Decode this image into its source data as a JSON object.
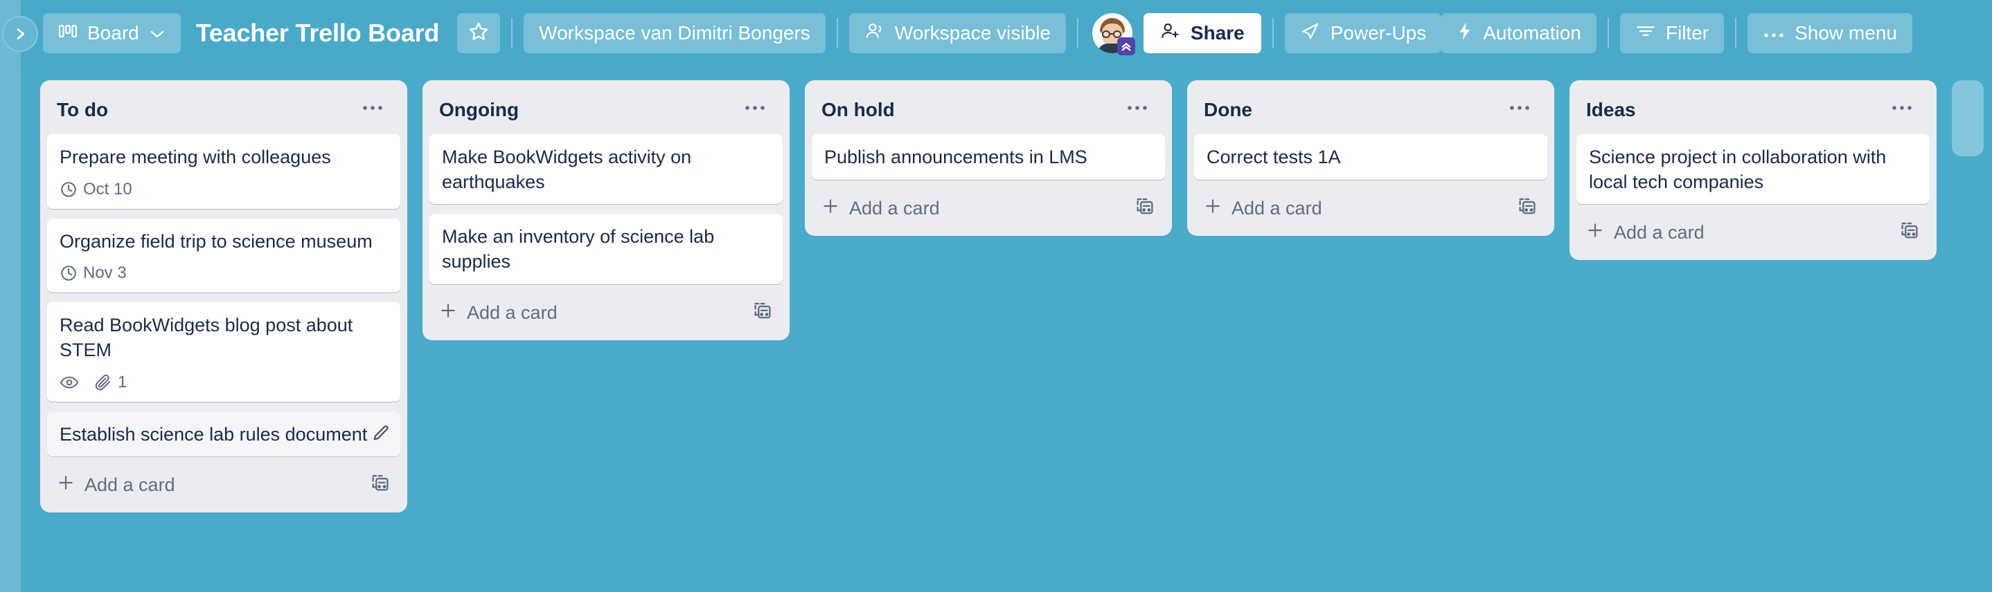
{
  "sidebar": {
    "expand_icon": "chevron-right-icon"
  },
  "topbar": {
    "board_switch": {
      "label": "Board",
      "icon": "board-columns-icon",
      "chevron": "chevron-down-icon"
    },
    "board_title": "Teacher Trello Board",
    "star": {
      "icon": "star-icon"
    },
    "workspace": {
      "label": "Workspace van Dimitri Bongers"
    },
    "visibility": {
      "label": "Workspace visible",
      "icon": "members-icon"
    },
    "avatar": {
      "name": "avatar",
      "badge": "premium-badge"
    },
    "share": {
      "label": "Share",
      "icon": "add-person-icon"
    },
    "power_ups": {
      "label": "Power-Ups",
      "icon": "rocket-icon"
    },
    "automation": {
      "label": "Automation",
      "icon": "bolt-icon"
    },
    "filter": {
      "label": "Filter",
      "icon": "filter-icon"
    },
    "show_menu": {
      "label": "Show menu",
      "icon": "ellipsis-icon"
    }
  },
  "board": {
    "add_card_label": "Add a card",
    "list_menu_icon": "ellipsis-icon",
    "template_icon": "card-template-icon",
    "add_card_icon": "plus-icon",
    "lists": [
      {
        "title": "To do",
        "cards": [
          {
            "title": "Prepare meeting with colleagues",
            "due": "Oct 10",
            "due_icon": "clock-icon"
          },
          {
            "title": "Organize field trip to science museum",
            "due": "Nov 3",
            "due_icon": "clock-icon"
          },
          {
            "title": "Read BookWidgets blog post about STEM",
            "watch_icon": "eye-icon",
            "attachment_icon": "paperclip-icon",
            "attachments": "1"
          },
          {
            "title": "Establish science lab rules document",
            "hovered": true,
            "edit_icon": "pencil-icon"
          }
        ]
      },
      {
        "title": "Ongoing",
        "cards": [
          {
            "title": "Make BookWidgets activity on earthquakes"
          },
          {
            "title": "Make an inventory of science lab supplies"
          }
        ]
      },
      {
        "title": "On hold",
        "cards": [
          {
            "title": "Publish announcements in LMS"
          }
        ]
      },
      {
        "title": "Done",
        "cards": [
          {
            "title": "Correct tests 1A"
          }
        ]
      },
      {
        "title": "Ideas",
        "cards": [
          {
            "title": "Science project in collaboration with local tech companies"
          }
        ]
      }
    ]
  },
  "colors": {
    "board_background": "#4aabcb",
    "topbar_background": "#49a9c9",
    "sidebar_strip": "#6cb9d3",
    "list_background": "#ebecf0",
    "card_background": "#ffffff",
    "text_primary": "#172b4d",
    "text_secondary": "#5e6c84",
    "premium_badge": "#5243aa"
  }
}
